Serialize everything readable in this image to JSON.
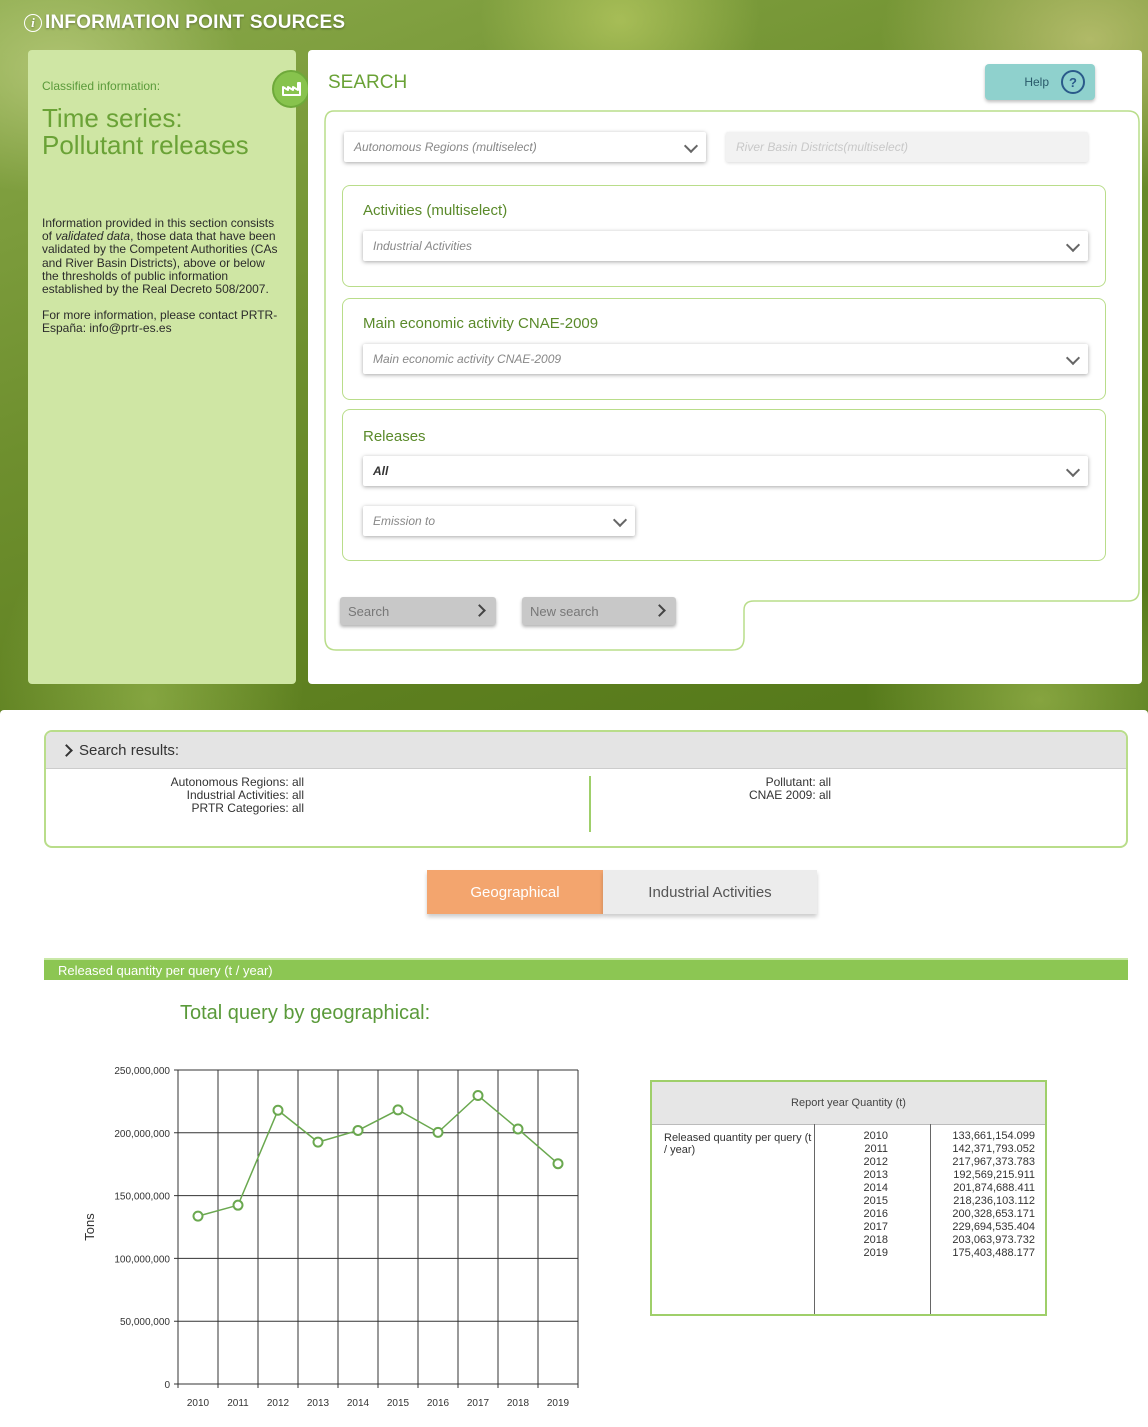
{
  "header": {
    "title": "INFORMATION POINT SOURCES"
  },
  "left_panel": {
    "classified_label": "Classified information:",
    "title_line1": "Time series:",
    "title_line2": "Pollutant releases",
    "desc_part1": "Information provided in this section consists of ",
    "desc_em": "validated data",
    "desc_part2": ", those data that have been validated by the Competent Authorities (CAs and River Basin Districts), above or below the thresholds of public information established by the Real Decreto 508/2007.",
    "contact": "For more information, please contact PRTR-España: info@prtr-es.es"
  },
  "search": {
    "title": "SEARCH",
    "help_label": "Help",
    "autonomous_regions_placeholder": "Autonomous Regions (multiselect)",
    "river_basin_placeholder": "River Basin Districts(multiselect)",
    "activities_label": "Activities (multiselect)",
    "activities_placeholder": "Industrial Activities",
    "cnae_label": "Main economic activity CNAE-2009",
    "cnae_placeholder": "Main economic activity CNAE-2009",
    "releases_label": "Releases",
    "releases_value": "All",
    "emission_placeholder": "Emission to",
    "search_button": "Search",
    "new_search_button": "New search"
  },
  "results": {
    "header": "Search results:",
    "left_lines": [
      "Autonomous Regions: all",
      "Industrial Activities: all",
      "PRTR Categories: all"
    ],
    "right_lines": [
      "Pollutant: all",
      "CNAE 2009: all"
    ],
    "tabs": [
      {
        "label": "Geographical",
        "active": true
      },
      {
        "label": "Industrial Activities",
        "active": false
      }
    ],
    "section_bar": "Released quantity per query (t / year)",
    "chart_title": "Total query by geographical:"
  },
  "chart_data": {
    "type": "line",
    "title": "Total query by geographical:",
    "xlabel": "",
    "ylabel": "Tons",
    "x": [
      "2010",
      "2011",
      "2012",
      "2013",
      "2014",
      "2015",
      "2016",
      "2017",
      "2018",
      "2019"
    ],
    "values": [
      133661154.099,
      142371793.052,
      217967373.783,
      192569215.911,
      201874688.411,
      218236103.112,
      200328653.171,
      229694535.404,
      203063973.732,
      175403488.177
    ],
    "ylim": [
      0,
      250000000
    ],
    "yticks": [
      "0",
      "50,000,000",
      "100,000,000",
      "150,000,000",
      "200,000,000",
      "250,000,000"
    ],
    "grid": true,
    "line_color": "#6aa84f"
  },
  "table": {
    "header": "Report year Quantity (t)",
    "row_label": "Released quantity per query (t / year)",
    "years": [
      "2010",
      "2011",
      "2012",
      "2013",
      "2014",
      "2015",
      "2016",
      "2017",
      "2018",
      "2019"
    ],
    "quantities": [
      "133,661,154.099",
      "142,371,793.052",
      "217,967,373.783",
      "192,569,215.911",
      "201,874,688.411",
      "218,236,103.112",
      "200,328,653.171",
      "229,694,535.404",
      "203,063,973.732",
      "175,403,488.177"
    ]
  }
}
